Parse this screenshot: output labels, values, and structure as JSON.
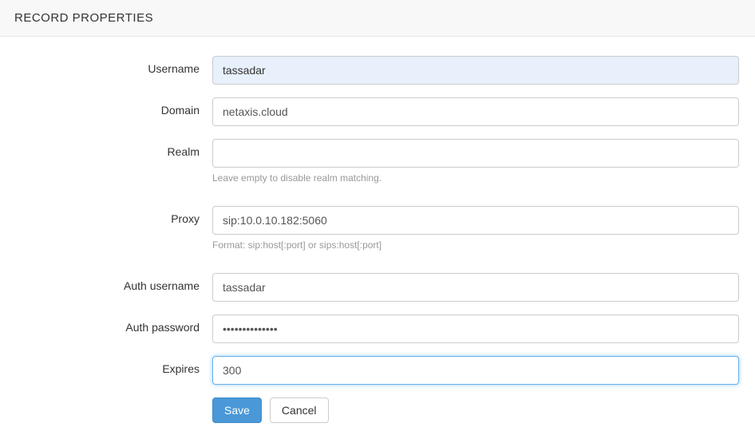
{
  "header": {
    "title": "RECORD PROPERTIES"
  },
  "form": {
    "username": {
      "label": "Username",
      "value": "tassadar"
    },
    "domain": {
      "label": "Domain",
      "value": "netaxis.cloud"
    },
    "realm": {
      "label": "Realm",
      "value": "",
      "help": "Leave empty to disable realm matching."
    },
    "proxy": {
      "label": "Proxy",
      "value": "sip:10.0.10.182:5060",
      "help": "Format: sip:host[:port] or sips:host[:port]"
    },
    "auth_username": {
      "label": "Auth username",
      "value": "tassadar"
    },
    "auth_password": {
      "label": "Auth password",
      "value": "••••••••••••••"
    },
    "expires": {
      "label": "Expires",
      "value": "300"
    }
  },
  "buttons": {
    "save": "Save",
    "cancel": "Cancel"
  }
}
